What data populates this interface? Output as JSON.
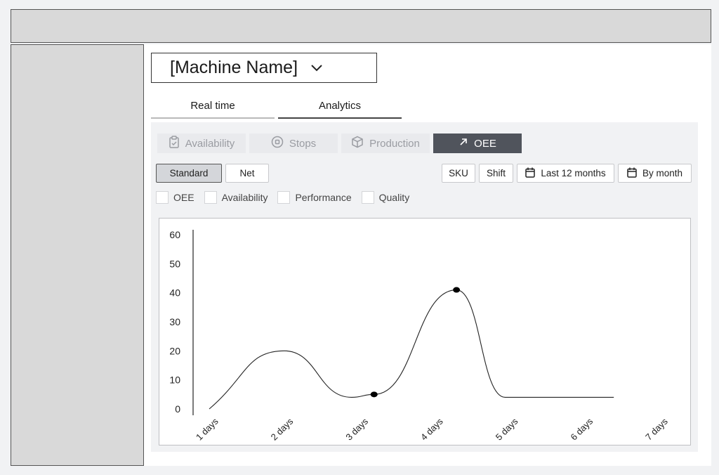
{
  "machine_selector": {
    "value": "[Machine Name]",
    "icon": "chevron-down-icon"
  },
  "view_tabs": [
    {
      "label": "Real time",
      "active": false
    },
    {
      "label": "Analytics",
      "active": true
    }
  ],
  "metric_tabs": [
    {
      "label": "Availability",
      "icon": "clipboard-check-icon",
      "active": false
    },
    {
      "label": "Stops",
      "icon": "stop-circle-icon",
      "active": false
    },
    {
      "label": "Production",
      "icon": "box-icon",
      "active": false
    },
    {
      "label": "OEE",
      "icon": "arrow-up-right-icon",
      "active": true
    }
  ],
  "mode_buttons": [
    {
      "label": "Standard",
      "selected": true
    },
    {
      "label": "Net",
      "selected": false
    }
  ],
  "filters": {
    "sku": "SKU",
    "shift": "Shift",
    "period": "Last 12 months",
    "grouping": "By month"
  },
  "checkboxes": [
    {
      "label": "OEE",
      "checked": false
    },
    {
      "label": "Availability",
      "checked": false
    },
    {
      "label": "Performance",
      "checked": false
    },
    {
      "label": "Quality",
      "checked": false
    }
  ],
  "colors": {
    "active_tab": "#50545c",
    "panel_bg": "#f1f2f4",
    "placeholder_gray": "#d9d9d9"
  },
  "chart_data": {
    "type": "line",
    "categories": [
      "1 days",
      "2 days",
      "3 days",
      "4 days",
      "5 days",
      "6 days",
      "7 days"
    ],
    "y_ticks": [
      "0",
      "10",
      "20",
      "30",
      "40",
      "50",
      "60"
    ],
    "ylim": [
      0,
      60
    ],
    "xlim": [
      1,
      7
    ],
    "series": [
      {
        "points": [
          [
            1,
            0
          ],
          [
            2,
            20
          ],
          [
            2.9,
            4
          ],
          [
            3.2,
            5
          ],
          [
            4.3,
            41
          ],
          [
            4.95,
            4
          ],
          [
            6.4,
            4
          ]
        ],
        "markers": [
          [
            3.2,
            5
          ],
          [
            4.3,
            41
          ]
        ]
      }
    ],
    "xlabel": "",
    "ylabel": "",
    "title": "",
    "grid": false
  }
}
